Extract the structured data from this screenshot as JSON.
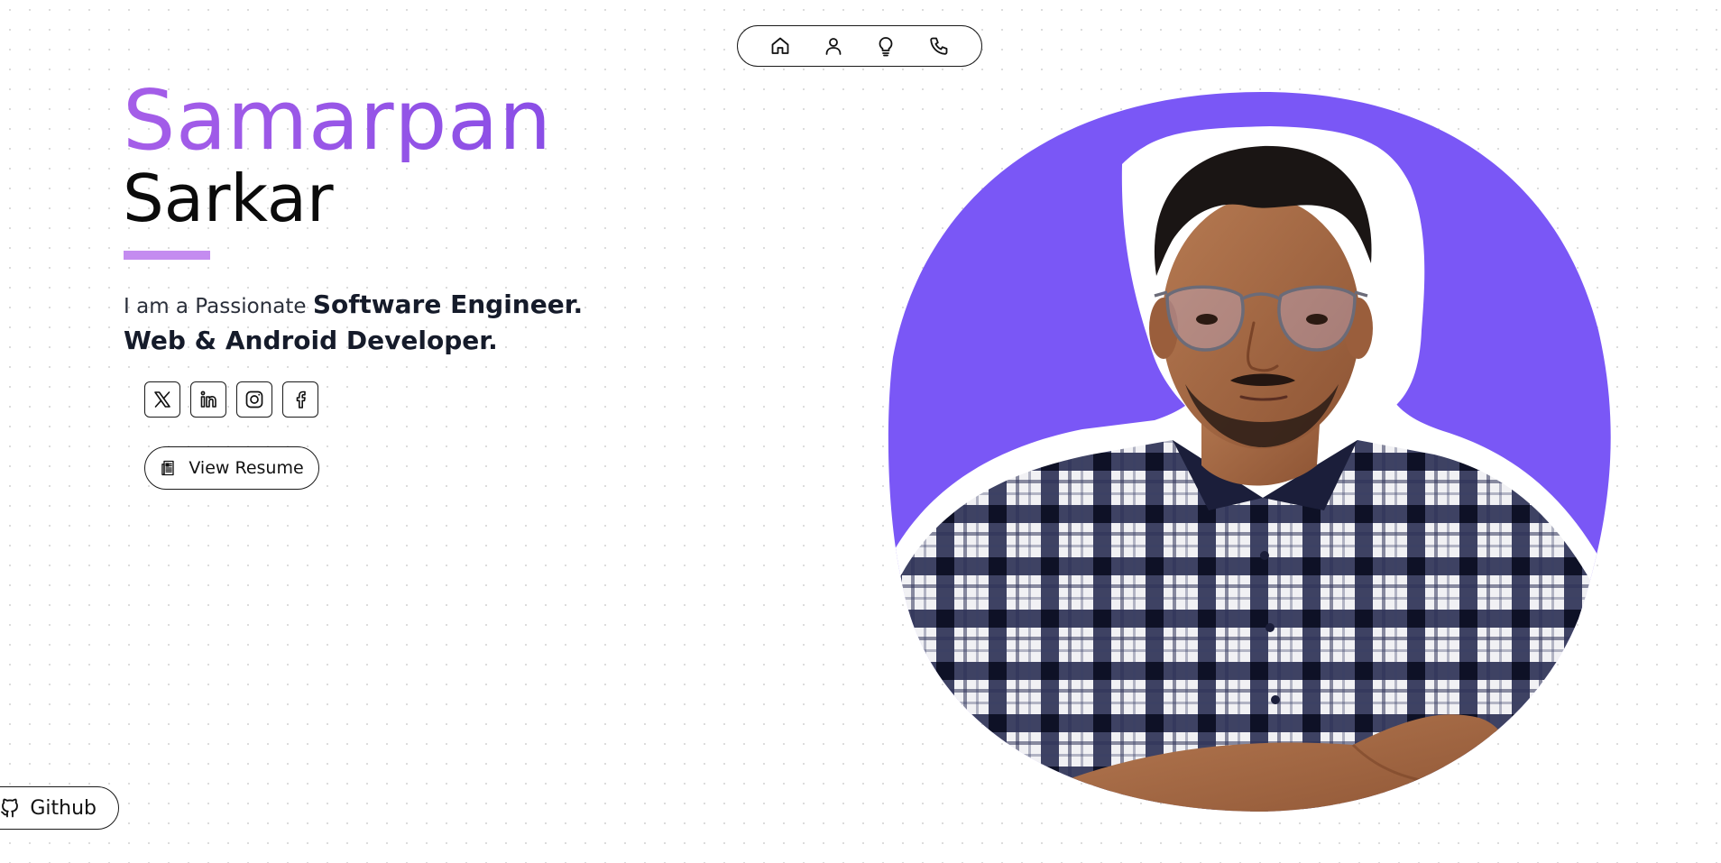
{
  "nav": {
    "items": [
      {
        "icon": "home-icon"
      },
      {
        "icon": "user-icon"
      },
      {
        "icon": "lightbulb-icon"
      },
      {
        "icon": "phone-icon"
      }
    ]
  },
  "hero": {
    "first_name": "Samarpan",
    "last_name": "Sarkar",
    "tagline_lead": "I am a Passionate ",
    "role_primary": "Software Engineer.",
    "role_secondary": "Web & Android Developer."
  },
  "socials": [
    {
      "icon": "x-twitter-icon"
    },
    {
      "icon": "linkedin-icon"
    },
    {
      "icon": "instagram-icon"
    },
    {
      "icon": "facebook-icon"
    }
  ],
  "resume_button": {
    "label": "View Resume",
    "icon": "document-icon"
  },
  "github_button": {
    "label": "Github",
    "icon": "github-icon"
  },
  "colors": {
    "accent_purple": "#8a4ee6",
    "name_gradient_start": "#a55ee8",
    "underline": "#c48cf0",
    "portrait_blob": "#7a57f6",
    "shirt_navy": "#262a4e"
  }
}
